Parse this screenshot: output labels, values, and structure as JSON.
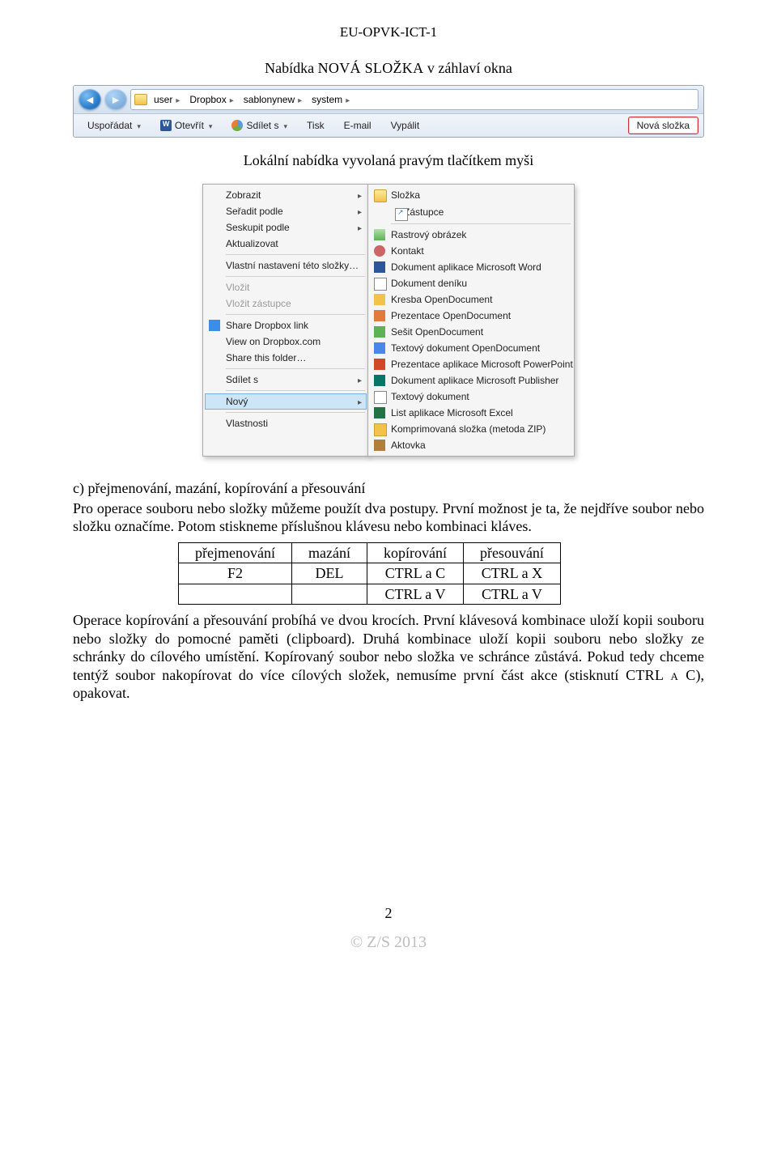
{
  "header": "EU-OPVK-ICT-1",
  "section1_title": "Nabídka NOVÁ SLOŽKA v záhlaví okna",
  "explorer": {
    "crumbs": [
      "user",
      "Dropbox",
      "sablonynew",
      "system"
    ],
    "toolbar": {
      "organize": "Uspořádat",
      "open": "Otevřít",
      "share": "Sdílet s",
      "print": "Tisk",
      "email": "E-mail",
      "burn": "Vypálit",
      "newfolder": "Nová složka"
    }
  },
  "caption2": "Lokální nabídka vyvolaná pravým tlačítkem myši",
  "context_menu": {
    "view": "Zobrazit",
    "sort": "Seřadit podle",
    "group": "Seskupit podle",
    "refresh": "Aktualizovat",
    "customize": "Vlastní nastavení této složky…",
    "paste": "Vložit",
    "paste_shortcut": "Vložit zástupce",
    "dropbox_share": "Share Dropbox link",
    "dropbox_view": "View on Dropbox.com",
    "dropbox_folder": "Share this folder…",
    "share_with": "Sdílet s",
    "new": "Nový",
    "properties": "Vlastnosti"
  },
  "submenu": {
    "folder": "Složka",
    "shortcut": "Zástupce",
    "bitmap": "Rastrový obrázek",
    "contact": "Kontakt",
    "word": "Dokument aplikace Microsoft Word",
    "journal": "Dokument deníku",
    "odg": "Kresba OpenDocument",
    "odp": "Prezentace OpenDocument",
    "ods": "Sešit OpenDocument",
    "odt": "Textový dokument OpenDocument",
    "ppt": "Prezentace aplikace Microsoft PowerPoint",
    "pub": "Dokument aplikace Microsoft Publisher",
    "txt": "Textový dokument",
    "xls": "List aplikace Microsoft Excel",
    "zip": "Komprimovaná složka (metoda ZIP)",
    "briefcase": "Aktovka"
  },
  "body": {
    "c_line": "c) přejmenování, mazání, kopírování a přesouvání",
    "p1": "Pro operace souboru nebo složky můžeme použít dva postupy. První možnost je ta, že nejdříve soubor nebo složku označíme. Potom stiskneme příslušnou klávesu nebo kombinaci kláves.",
    "table_headers": [
      "přejmenování",
      "mazání",
      "kopírování",
      "přesouvání"
    ],
    "table_rows": [
      [
        "F2",
        "DEL",
        "CTRL a C",
        "CTRL a X"
      ],
      [
        "",
        "",
        "CTRL a V",
        "CTRL a V"
      ]
    ],
    "p2a": "Operace kopírování a přesouvání probíhá ve dvou krocích. První klávesová kombinace uloží kopii souboru nebo složky do pomocné paměti (clipboard). Druhá kombinace uloží kopii souboru nebo složky ze schránky do cílového umístění. Kopírovaný soubor nebo složka ve schránce zůstává. Pokud tedy chceme tentýž soubor nakopírovat do více cílových složek, nemusíme první část akce (stisknutí ",
    "p2b": "CTRL a C",
    "p2c": "), opakovat."
  },
  "page_number": "2",
  "footer": "© Z/S 2013"
}
